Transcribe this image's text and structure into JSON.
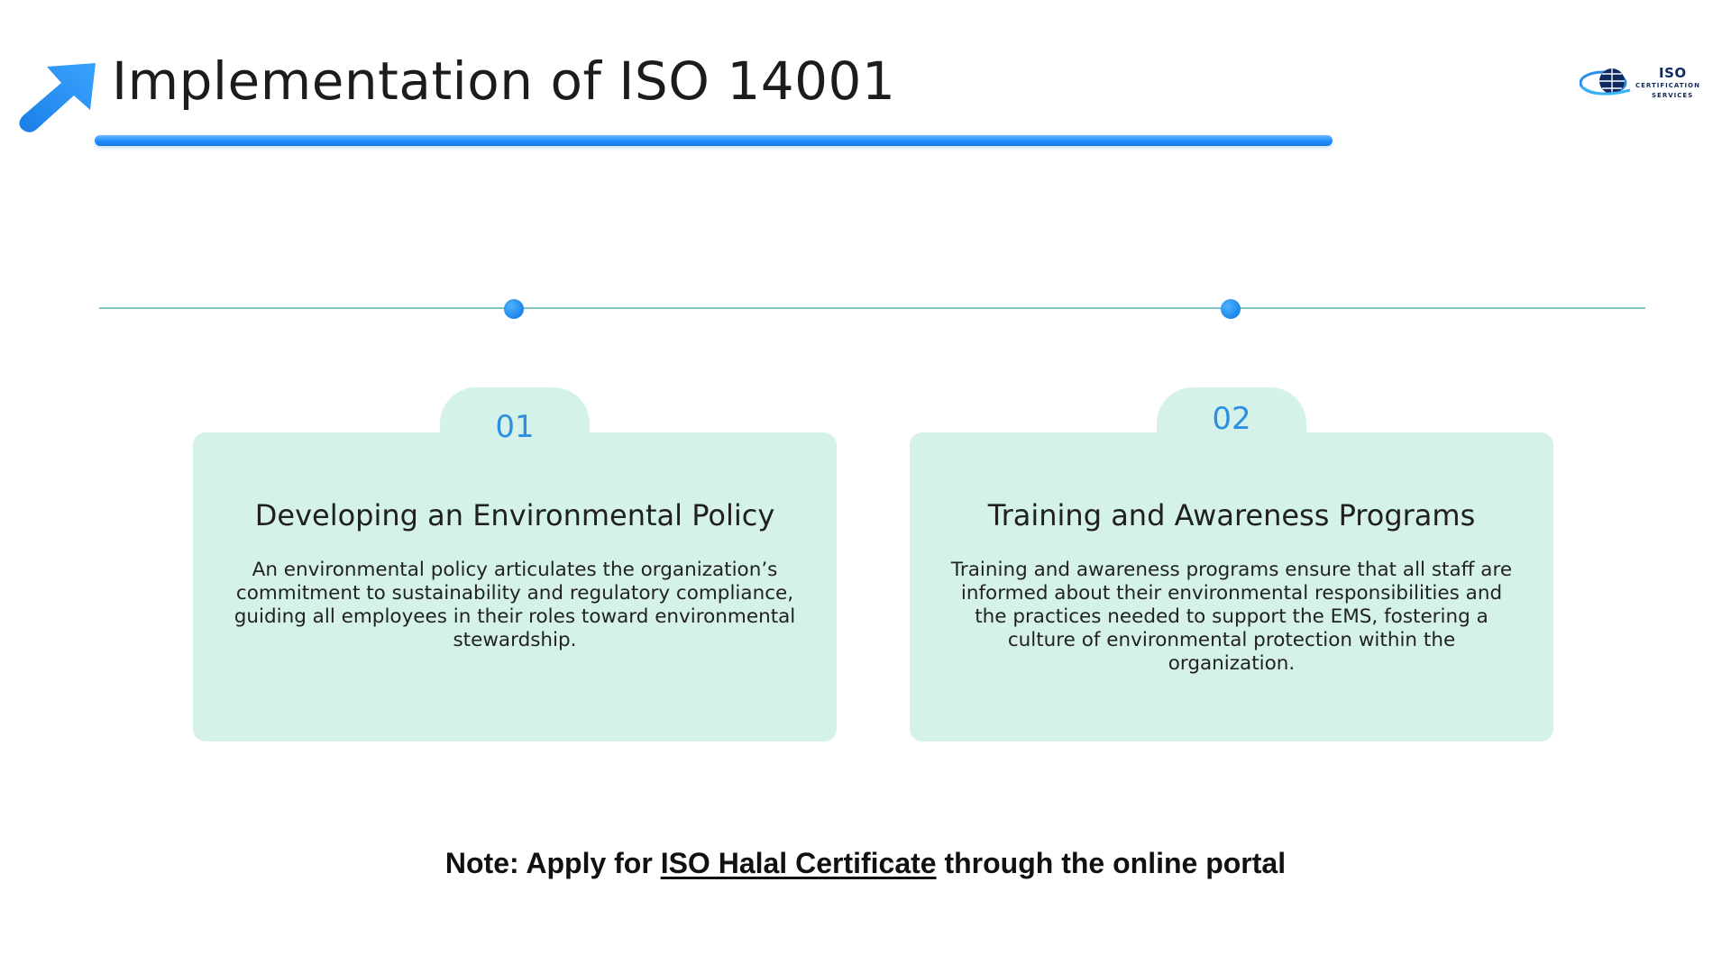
{
  "header": {
    "title": "Implementation of ISO 14001",
    "icon": "arrow-up-right-icon",
    "accent_color": "#1e8fff"
  },
  "logo": {
    "line1": "ISO",
    "line2": "CERTIFICATION",
    "line3": "SERVICES",
    "icon": "globe-icon"
  },
  "cards": [
    {
      "number": "01",
      "title": "Developing an Environmental Policy",
      "body": "An environmental policy articulates the organization’s commitment to sustainability and regulatory compliance, guiding all employees in their roles toward environmental stewardship."
    },
    {
      "number": "02",
      "title": "Training and Awareness Programs",
      "body": "Training and awareness programs ensure that all staff are informed about their environmental responsibilities and the practices needed to support the EMS, fostering a culture of environmental protection within the organization."
    }
  ],
  "note": {
    "prefix": "Note: Apply for ",
    "link_text": "ISO Halal Certificate",
    "suffix": " through the online portal"
  },
  "colors": {
    "card_background": "#d5f2ea",
    "timeline": "#7fc3c7",
    "dot": "#1a86e8",
    "number": "#2d8fe0"
  }
}
